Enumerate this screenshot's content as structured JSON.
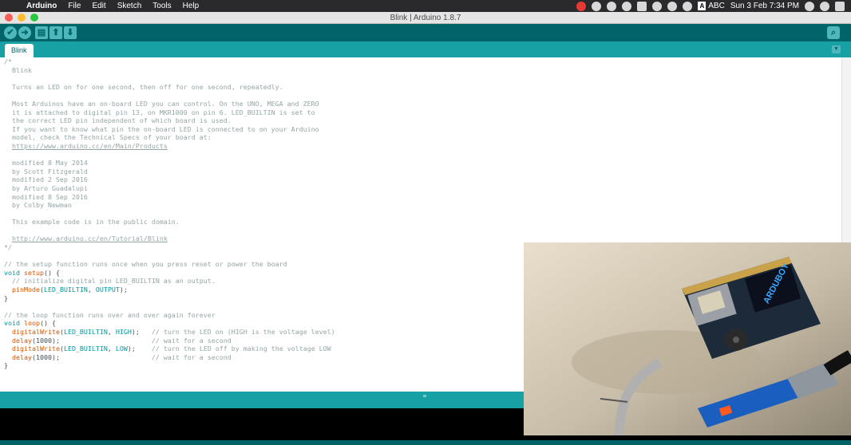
{
  "menubar": {
    "items": [
      "Arduino",
      "File",
      "Edit",
      "Sketch",
      "Tools",
      "Help"
    ],
    "input_source": "A",
    "input_label": "ABC",
    "clock": "Sun 3 Feb  7:34 PM"
  },
  "window": {
    "title": "Blink | Arduino 1.8.7"
  },
  "toolbar": {
    "verify_icon": "✔",
    "upload_icon": "➜",
    "new_icon": "▤",
    "open_icon": "⬆",
    "save_icon": "⬇",
    "serial_icon": "⌕"
  },
  "tabs": [
    {
      "label": "Blink"
    }
  ],
  "tab_menu_icon": "▼",
  "editor": {
    "lines": [
      "/*",
      "  Blink",
      "",
      "  Turns an LED on for one second, then off for one second, repeatedly.",
      "",
      "  Most Arduinos have an on-board LED you can control. On the UNO, MEGA and ZERO",
      "  it is attached to digital pin 13, on MKR1000 on pin 6. LED_BUILTIN is set to",
      "  the correct LED pin independent of which board is used.",
      "  If you want to know what pin the on-board LED is connected to on your Arduino",
      "  model, check the Technical Specs of your board at:",
      "  https://www.arduino.cc/en/Main/Products",
      "",
      "  modified 8 May 2014",
      "  by Scott Fitzgerald",
      "  modified 2 Sep 2016",
      "  by Arturo Guadalupi",
      "  modified 8 Sep 2016",
      "  by Colby Newman",
      "",
      "  This example code is in the public domain.",
      "",
      "  http://www.arduino.cc/en/Tutorial/Blink",
      "*/",
      "",
      "// the setup function runs once when you press reset or power the board",
      "void setup() {",
      "  // initialize digital pin LED_BUILTIN as an output.",
      "  pinMode(LED_BUILTIN, OUTPUT);",
      "}",
      "",
      "// the loop function runs over and over again forever",
      "void loop() {",
      "  digitalWrite(LED_BUILTIN, HIGH);   // turn the LED on (HIGH is the voltage level)",
      "  delay(1000);                       // wait for a second",
      "  digitalWrite(LED_BUILTIN, LOW);    // turn the LED off by making the voltage LOW",
      "  delay(1000);                       // wait for a second",
      "}"
    ]
  },
  "camera": {
    "board_label": "ARDUBOY"
  },
  "colors": {
    "toolbar": "#006468",
    "tabstrip": "#17a1a5",
    "keyword": "#00979c",
    "function": "#d35400",
    "comment": "#95a5a6"
  }
}
